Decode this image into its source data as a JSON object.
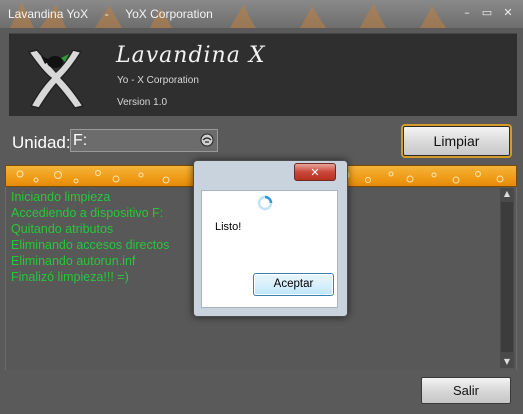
{
  "window": {
    "title": "Lavandina YoX     -     YoX Corporation",
    "controls": [
      "minimize-icon",
      "maximize-icon",
      "close-icon"
    ]
  },
  "header": {
    "app_name": "Lavandina X",
    "company": "Yo - X Corporation",
    "version": "Version 1.0"
  },
  "drive": {
    "label": "Unidad:",
    "value": "F:"
  },
  "buttons": {
    "clean": "Limpiar",
    "exit": "Salir"
  },
  "log": {
    "lines": [
      "Iniciando limpieza",
      "Accediendo a dispositivo  F:",
      "Quitando atributos",
      "Eliminando accesos directos",
      "Eliminando autorun.inf",
      "Finalizó limpieza!!! =)"
    ]
  },
  "dialog": {
    "message": "Listo!",
    "ok_label": "Aceptar",
    "close_glyph": "✕"
  },
  "colors": {
    "log_text": "#27c63c",
    "progress": "#f09b17",
    "accent_button": "#d49a2a"
  }
}
